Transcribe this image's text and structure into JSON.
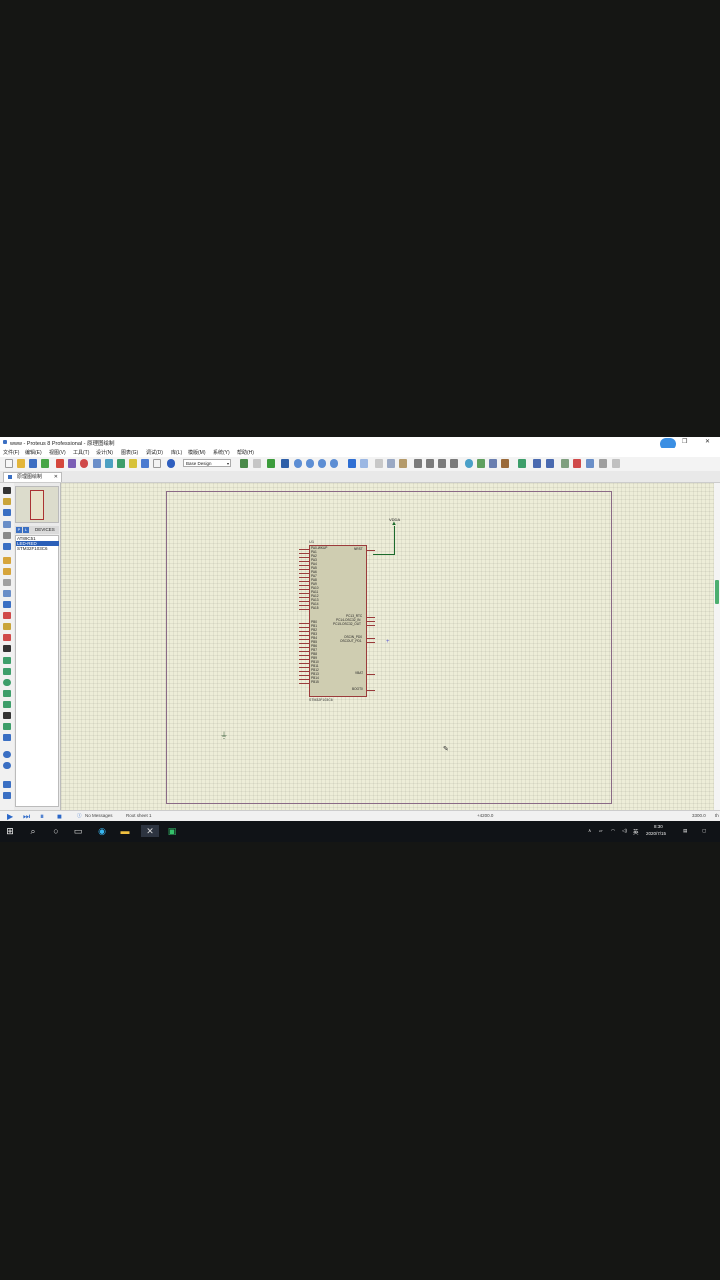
{
  "window": {
    "title": "www - Proteus 8 Professional - 原理图绘制",
    "controls": [
      "—",
      "❐",
      "✕"
    ]
  },
  "menu": [
    "文件(F)",
    "编辑(E)",
    "视图(V)",
    "工具(T)",
    "设计(N)",
    "图表(G)",
    "调试(D)",
    "库(L)",
    "模版(M)",
    "系统(Y)",
    "帮助(H)"
  ],
  "toolbar": {
    "design_select": "Base Design"
  },
  "tab": {
    "label": "原理图绘制",
    "close": "✕"
  },
  "devices": {
    "header_p": "P",
    "header_l": "L",
    "header_label": "DEVICES",
    "items": [
      {
        "label": "AT89C51",
        "selected": false
      },
      {
        "label": "LED-RED",
        "selected": true
      },
      {
        "label": "STM32F103C6",
        "selected": false
      }
    ]
  },
  "schematic": {
    "chip_ref": "U1",
    "chip_part": "STM32F103C6",
    "left_pins_top": [
      "PA0-WKUP",
      "PA1",
      "PA2",
      "PA3",
      "PA4",
      "PA5",
      "PA6",
      "PA7",
      "PA8",
      "PA9",
      "PA10",
      "PA11",
      "PA12",
      "PA13",
      "PA14",
      "PA15"
    ],
    "left_pins_bottom": [
      "PB0",
      "PB1",
      "PB2",
      "PB3",
      "PB4",
      "PB5",
      "PB6",
      "PB7",
      "PB8",
      "PB9",
      "PB10",
      "PB11",
      "PB12",
      "PB13",
      "PB14",
      "PB15"
    ],
    "right_pins": [
      {
        "label": "NRST"
      },
      {
        "label": "PC13_RTC"
      },
      {
        "label": "PC14-OSC32_IN"
      },
      {
        "label": "PC15-OSC32_OUT"
      },
      {
        "label": "OSCIN_PD0"
      },
      {
        "label": "OSCOUT_PD1"
      },
      {
        "label": "VBAT"
      },
      {
        "label": "BOOT0"
      }
    ],
    "power_label": "VDDA"
  },
  "status": {
    "messages": "No Messages",
    "sheet": "Root sheet 1",
    "coord_x": "+4200.0",
    "coord_y": "3300.0",
    "unit": "th"
  },
  "taskbar": {
    "time": "8:30",
    "date": "2020/7/15",
    "ime": "英"
  }
}
